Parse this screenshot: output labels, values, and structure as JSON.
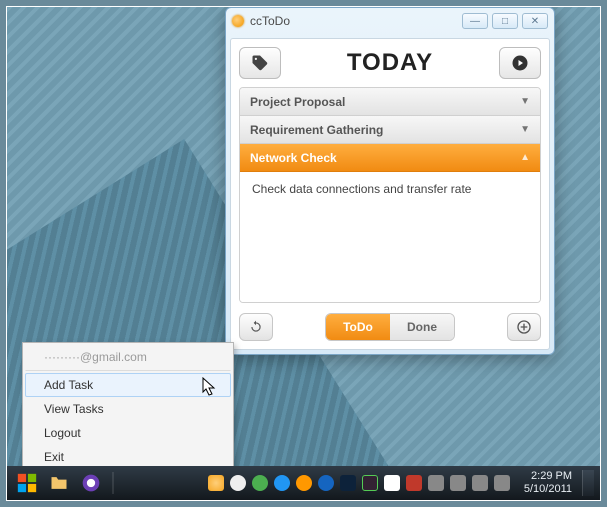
{
  "window": {
    "title": "ccToDo",
    "header": "TODAY"
  },
  "tasks": [
    {
      "label": "Project Proposal",
      "expanded": false
    },
    {
      "label": "Requirement Gathering",
      "expanded": false
    },
    {
      "label": "Network Check",
      "expanded": true,
      "body": "Check data connections and transfer rate"
    }
  ],
  "footer": {
    "todo": "ToDo",
    "done": "Done"
  },
  "context_menu": {
    "account": "·········@gmail.com",
    "items": [
      "Add Task",
      "View Tasks",
      "Logout",
      "Exit"
    ],
    "hovered_index": 0
  },
  "clock": {
    "time": "2:29 PM",
    "date": "5/10/2011"
  },
  "tray_icon_names": [
    "cctodo-icon",
    "chat-icon",
    "sync-icon",
    "world-icon",
    "updater-icon",
    "info-icon",
    "amazon-icon",
    "grid-icon",
    "flag-icon",
    "notify-icon",
    "shield-icon",
    "device-icon",
    "network-icon",
    "volume-icon"
  ]
}
